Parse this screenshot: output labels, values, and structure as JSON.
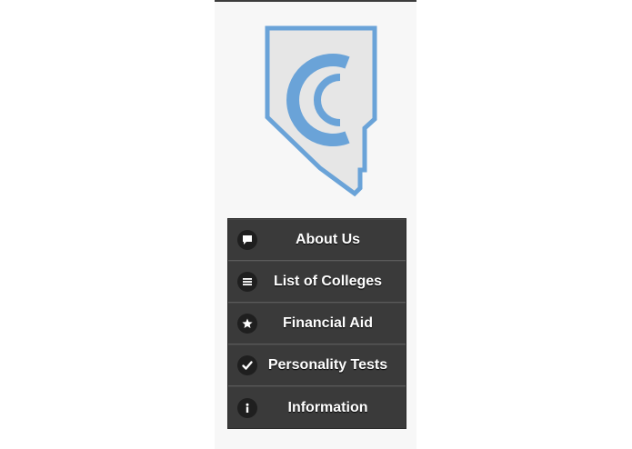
{
  "colors": {
    "logo_blue": "#6aa3d8",
    "logo_fill": "#e6e6e6",
    "nav_background": "#3a3a3a",
    "nav_text": "#ffffff"
  },
  "nav": {
    "items": [
      {
        "label": "About Us",
        "icon": "speech-bubble-icon"
      },
      {
        "label": "List of Colleges",
        "icon": "list-icon"
      },
      {
        "label": "Financial Aid",
        "icon": "star-icon"
      },
      {
        "label": "Personality Tests",
        "icon": "checkmark-icon"
      },
      {
        "label": "Information",
        "icon": "info-icon"
      }
    ]
  }
}
